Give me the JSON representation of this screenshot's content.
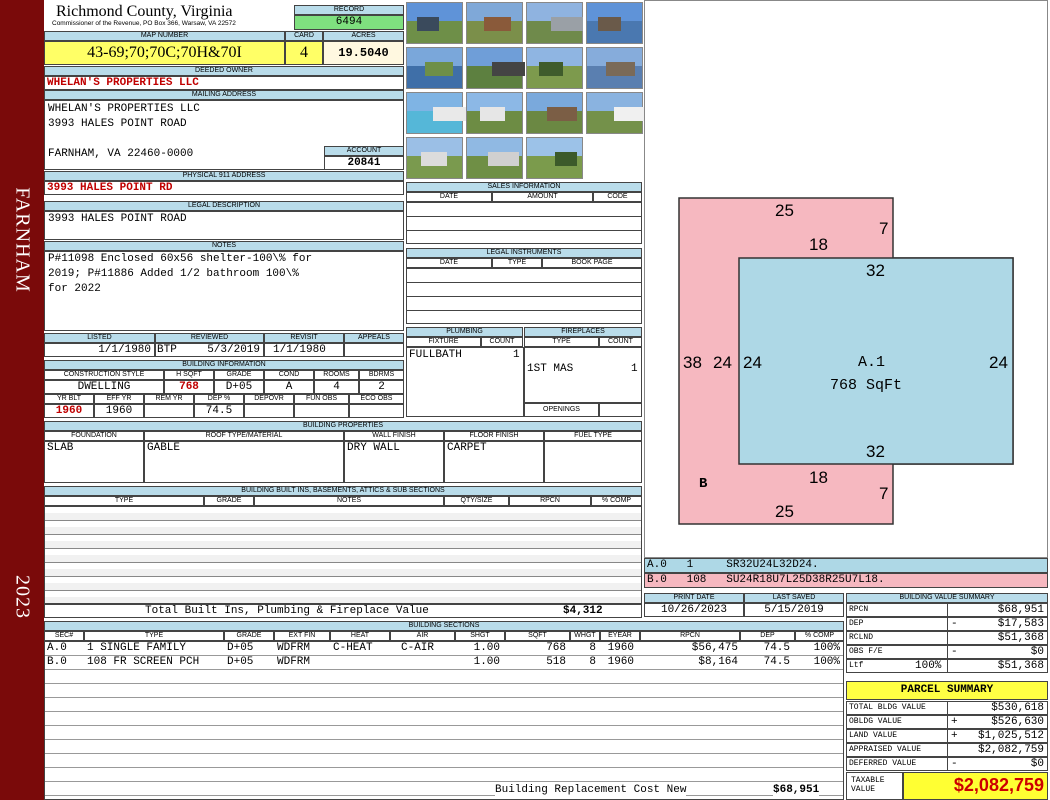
{
  "side": {
    "city": "FARNHAM",
    "year": "2023"
  },
  "county": {
    "name": "Richmond County, Virginia",
    "address": "Commissioner of the Revenue, PO Box 366, Warsaw, VA 22572"
  },
  "record": {
    "label": "RECORD",
    "value": "6494"
  },
  "map": {
    "label": "MAP NUMBER",
    "value": "43-69;70;70C;70H&70I"
  },
  "card": {
    "label": "CARD",
    "value": "4"
  },
  "acres": {
    "label": "ACRES",
    "value": "19.5040"
  },
  "owner": {
    "label": "DEEDED OWNER",
    "value": "WHELAN'S PROPERTIES LLC"
  },
  "mailing": {
    "label": "MAILING ADDRESS",
    "line1": "WHELAN'S PROPERTIES LLC",
    "line2": "3993 HALES POINT ROAD",
    "line3": "FARNHAM, VA 22460-0000"
  },
  "account": {
    "label": "ACCOUNT",
    "value": "20841"
  },
  "physical": {
    "label": "PHYSICAL 911 ADDRESS",
    "value": "3993 HALES POINT RD"
  },
  "legal": {
    "label": "LEGAL DESCRIPTION",
    "value": "3993 HALES POINT ROAD"
  },
  "notes": {
    "label": "NOTES",
    "line1": "P#11098 Enclosed 60x56 shelter-100\\% for",
    "line2": "2019; P#11886 Added 1/2 bathroom 100\\%",
    "line3": "for 2022"
  },
  "dates": {
    "listed_label": "LISTED",
    "listed": "1/1/1980",
    "reviewed_label": "REVIEWED",
    "reviewed_by": "BTP",
    "reviewed": "5/3/2019",
    "revisit_label": "REVISIT",
    "revisit": "1/1/1980",
    "appeals_label": "APPEALS"
  },
  "building_info": {
    "label": "BUILDING INFORMATION",
    "h1": "CONSTRUCTION STYLE",
    "h2": "H SQFT",
    "h3": "GRADE",
    "h4": "COND",
    "h5": "ROOMS",
    "h6": "BDRMS",
    "v1": "DWELLING",
    "v2": "768",
    "v3": "D+05",
    "v4": "A",
    "v5": "4",
    "v6": "2",
    "h7": "YR BLT",
    "h8": "EFF YR",
    "h9": "REM YR",
    "h10": "DEP %",
    "h11": "DEPOVR",
    "h12": "FUN OBS",
    "h13": "ECO OBS",
    "v7": "1960",
    "v8": "1960",
    "v10": "74.5"
  },
  "sales": {
    "label": "SALES INFORMATION",
    "date": "DATE",
    "amount": "AMOUNT",
    "code": "CODE"
  },
  "instruments": {
    "label": "LEGAL INSTRUMENTS",
    "date": "DATE",
    "type": "TYPE",
    "bookpage": "BOOK PAGE"
  },
  "plumbing": {
    "label": "PLUMBING",
    "fixture": "FIXTURE",
    "count": "COUNT",
    "r1_fixture": "FULLBATH",
    "r1_count": "1"
  },
  "fireplaces": {
    "label": "FIREPLACES",
    "type": "TYPE",
    "count": "COUNT",
    "r1_type": "1ST MAS",
    "r1_count": "1",
    "openings": "OPENINGS"
  },
  "properties": {
    "label": "BUILDING PROPERTIES",
    "foundation": "FOUNDATION",
    "roof": "ROOF TYPE/MATERIAL",
    "wall": "WALL FINISH",
    "floor": "FLOOR FINISH",
    "fuel": "FUEL TYPE",
    "v_foundation": "SLAB",
    "v_roof": "GABLE",
    "v_wall": "DRY WALL",
    "v_floor": "CARPET"
  },
  "builtins": {
    "label": "BUILDING BUILT INS, BASEMENTS, ATTICS & SUB SECTIONS",
    "type": "TYPE",
    "grade": "GRADE",
    "notes": "NOTES",
    "qty": "QTY/SIZE",
    "rpcn": "RPCN",
    "comp": "% COMP",
    "total_label": "Total Built Ins, Plumbing & Fireplace Value",
    "total_value": "$4,312"
  },
  "print": {
    "print_label": "PRINT DATE",
    "print_date": "10/26/2023",
    "saved_label": "LAST SAVED",
    "saved_date": "5/15/2019"
  },
  "sections": {
    "label": "BUILDING SECTIONS",
    "h_sec": "SEC#",
    "h_type": "TYPE",
    "h_grade": "GRADE",
    "h_ext": "EXT FIN",
    "h_heat": "HEAT",
    "h_air": "AIR",
    "h_shgt": "SHGT",
    "h_sqft": "SQFT",
    "h_whgt": "WHGT",
    "h_eyear": "EYEAR",
    "h_rpcn": "RPCN",
    "h_dep": "DEP",
    "h_comp": "% COMP",
    "rows": [
      {
        "sec": "A.0",
        "type": "1 SINGLE FAMILY",
        "grade": "D+05",
        "ext": "WDFRM",
        "heat": "C-HEAT",
        "air": "C-AIR",
        "shgt": "1.00",
        "sqft": "768",
        "whgt": "8",
        "eyear": "1960",
        "rpcn": "$56,475",
        "dep": "74.5",
        "comp": "100%"
      },
      {
        "sec": "B.0",
        "type": "108 FR SCREEN PCH",
        "grade": "D+05",
        "ext": "WDFRM",
        "heat": "",
        "air": "",
        "shgt": "1.00",
        "sqft": "518",
        "whgt": "8",
        "eyear": "1960",
        "rpcn": "$8,164",
        "dep": "74.5",
        "comp": "100%"
      }
    ],
    "replacement_label": "Building Replacement Cost New",
    "replacement_value": "$68,951"
  },
  "sketch": {
    "colors": {
      "pink": "#f6b8c0",
      "blue": "#aed8e6"
    },
    "dims": {
      "t25": "25",
      "t7": "7",
      "t18": "18",
      "l38": "38",
      "l24": "24",
      "a24l": "24",
      "a24r": "24",
      "a32t": "32",
      "a32b": "32",
      "b18": "18",
      "b7": "7",
      "b25": "25"
    },
    "a_label": "A.1",
    "a_area": "768 SqFt",
    "b_label": "B",
    "line_a": "A.0   1     SR32U24L32D24.",
    "line_b": "B.0   108   SU24R18U7L25D38R25U7L18."
  },
  "bvs": {
    "label": "BUILDING VALUE SUMMARY",
    "rpcn_k": "RPCN",
    "rpcn_v": "$68,951",
    "dep_k": "DEP",
    "dep_s": "-",
    "dep_v": "$17,583",
    "rclnd_k": "RCLND",
    "rclnd_v": "$51,368",
    "obs_k": "OBS F/E",
    "obs_s": "-",
    "obs_v": "$0",
    "ltf_k": "Ltf",
    "ltf_p": "100%",
    "ltf_v": "$51,368"
  },
  "parcel": {
    "label": "PARCEL SUMMARY",
    "tbv_k": "TOTAL BLDG VALUE",
    "tbv_v": "$530,618",
    "obldg_k": "OBLDG VALUE",
    "obldg_s": "+",
    "obldg_v": "$526,630",
    "land_k": "LAND VALUE",
    "land_s": "+",
    "land_v": "$1,025,512",
    "appr_k": "APPRAISED VALUE",
    "appr_v": "$2,082,759",
    "def_k": "DEFERRED VALUE",
    "def_s": "-",
    "def_v": "$0",
    "tax_k1": "TAXABLE",
    "tax_k2": "VALUE",
    "tax_v": "$2,082,759"
  },
  "photos": [
    {
      "name": "photo-house-front",
      "sky": "#5f93d8",
      "ground": "#6e8f48",
      "obj": "#3a4a5c"
    },
    {
      "name": "photo-gazebo",
      "sky": "#7fa8d8",
      "ground": "#7b8f4a",
      "obj": "#8a5a3a"
    },
    {
      "name": "photo-metal-shed",
      "sky": "#8fb3e0",
      "ground": "#6f8a4b",
      "obj": "#9aa0a6"
    },
    {
      "name": "photo-pier-water",
      "sky": "#5f93d8",
      "ground": "#4a78b0",
      "obj": "#6a5a4a"
    },
    {
      "name": "photo-shoreline",
      "sky": "#7aa7da",
      "ground": "#3f6fa8",
      "obj": "#6e8f48"
    },
    {
      "name": "photo-boathouse",
      "sky": "#6f9ed8",
      "ground": "#5d8040",
      "obj": "#444444"
    },
    {
      "name": "photo-lawn-trees",
      "sky": "#8fb5e2",
      "ground": "#7d9a4d",
      "obj": "#3f5c2c"
    },
    {
      "name": "photo-dock",
      "sky": "#86acdb",
      "ground": "#5a7fb0",
      "obj": "#7a6a58"
    },
    {
      "name": "photo-pool",
      "sky": "#7fb4e4",
      "ground": "#55b7d8",
      "obj": "#e9e9e9"
    },
    {
      "name": "photo-mobile-home",
      "sky": "#8cb8e6",
      "ground": "#6d8c44",
      "obj": "#e6e6e6"
    },
    {
      "name": "photo-cottage",
      "sky": "#7aa9dc",
      "ground": "#6b8843",
      "obj": "#7b5e45"
    },
    {
      "name": "photo-white-house",
      "sky": "#8ab3e0",
      "ground": "#74914a",
      "obj": "#f0f0f0"
    },
    {
      "name": "photo-trailer",
      "sky": "#9bbfe6",
      "ground": "#7a9a4e",
      "obj": "#dcdcdc"
    },
    {
      "name": "photo-trailer-2",
      "sky": "#90b9e3",
      "ground": "#6f8f45",
      "obj": "#d0d0d0"
    },
    {
      "name": "photo-pine-field",
      "sky": "#9cc2e8",
      "ground": "#7b9b4c",
      "obj": "#3c5a2a"
    }
  ]
}
